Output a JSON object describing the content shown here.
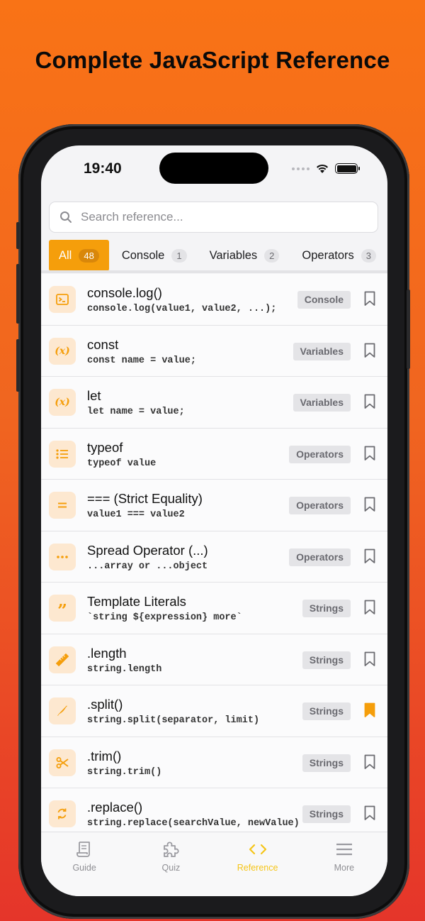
{
  "headline": "Complete JavaScript Reference",
  "status": {
    "time": "19:40"
  },
  "search": {
    "placeholder": "Search reference..."
  },
  "tabs": [
    {
      "label": "All",
      "count": "48"
    },
    {
      "label": "Console",
      "count": "1"
    },
    {
      "label": "Variables",
      "count": "2"
    },
    {
      "label": "Operators",
      "count": "3"
    }
  ],
  "items": [
    {
      "title": "console.log()",
      "syntax": "console.log(value1, value2, ...);",
      "category": "Console",
      "icon": "terminal-icon",
      "bookmarked": false
    },
    {
      "title": "const",
      "syntax": "const name = value;",
      "category": "Variables",
      "icon": "variable-icon",
      "bookmarked": false
    },
    {
      "title": "let",
      "syntax": "let name = value;",
      "category": "Variables",
      "icon": "variable-icon",
      "bookmarked": false
    },
    {
      "title": "typeof",
      "syntax": "typeof value",
      "category": "Operators",
      "icon": "list-icon",
      "bookmarked": false
    },
    {
      "title": "=== (Strict Equality)",
      "syntax": "value1 === value2",
      "category": "Operators",
      "icon": "equals-icon",
      "bookmarked": false
    },
    {
      "title": "Spread Operator (...)",
      "syntax": "...array or ...object",
      "category": "Operators",
      "icon": "ellipsis-icon",
      "bookmarked": false
    },
    {
      "title": "Template Literals",
      "syntax": "`string ${expression} more`",
      "category": "Strings",
      "icon": "quote-icon",
      "bookmarked": false
    },
    {
      "title": ".length",
      "syntax": "string.length",
      "category": "Strings",
      "icon": "ruler-icon",
      "bookmarked": false
    },
    {
      "title": ".split()",
      "syntax": "string.split(separator, limit)",
      "category": "Strings",
      "icon": "knife-icon",
      "bookmarked": true
    },
    {
      "title": ".trim()",
      "syntax": "string.trim()",
      "category": "Strings",
      "icon": "scissors-icon",
      "bookmarked": false
    },
    {
      "title": ".replace()",
      "syntax": "string.replace(searchValue, newValue)",
      "category": "Strings",
      "icon": "replace-icon",
      "bookmarked": false
    }
  ],
  "tabbar": [
    {
      "label": "Guide",
      "icon": "scroll-icon"
    },
    {
      "label": "Quiz",
      "icon": "puzzle-icon"
    },
    {
      "label": "Reference",
      "icon": "code-icon",
      "active": true
    },
    {
      "label": "More",
      "icon": "menu-icon"
    }
  ],
  "colors": {
    "accent": "#f59e0b",
    "active_tab": "#f5c518",
    "icon_bg": "#fde8d0"
  }
}
